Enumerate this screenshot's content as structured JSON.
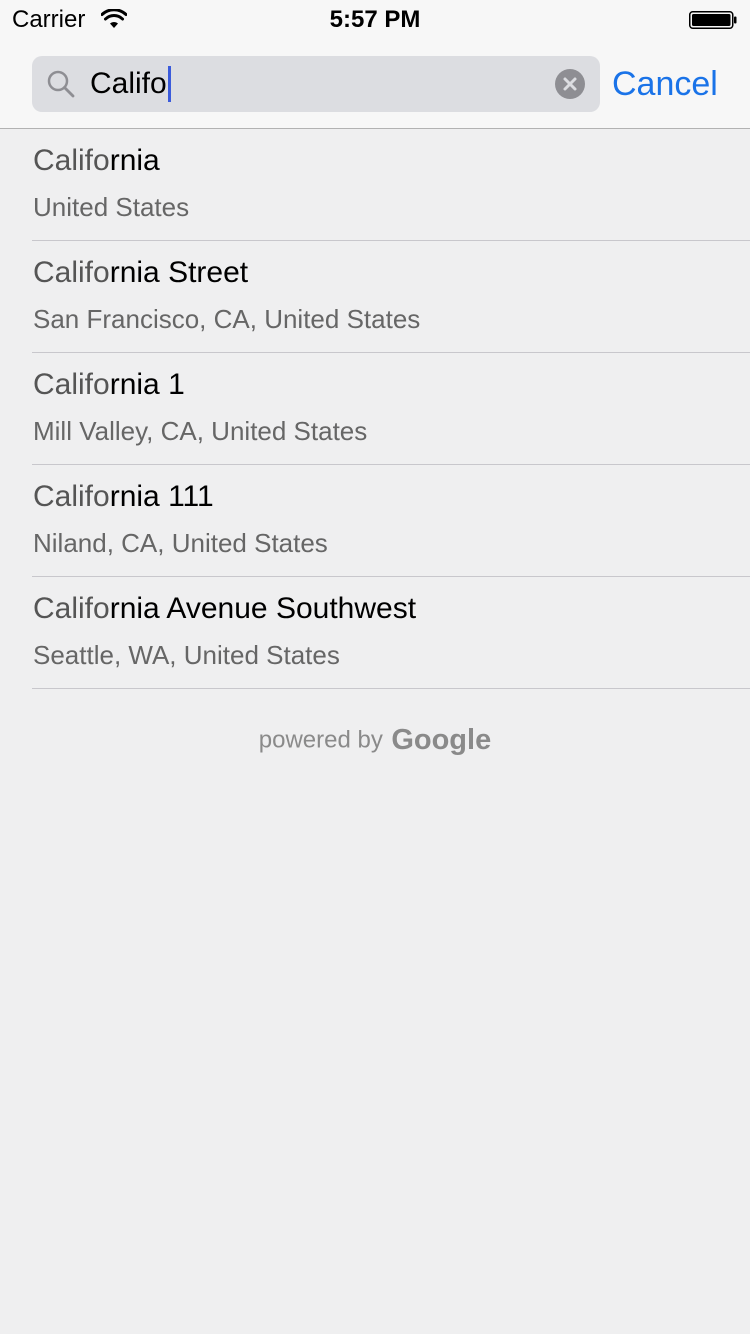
{
  "status_bar": {
    "carrier": "Carrier",
    "time": "5:57 PM",
    "icons": [
      "wifi-icon",
      "battery-icon"
    ]
  },
  "search": {
    "value": "Califo",
    "placeholder": "",
    "cancel_label": "Cancel",
    "icons": [
      "search-icon",
      "clear-icon"
    ],
    "accent_color": "#1a73e8",
    "caret_color": "#3b5bdb"
  },
  "results": [
    {
      "match": "Califo",
      "rest": "rnia",
      "subtitle": "United States"
    },
    {
      "match": "Califo",
      "rest": "rnia Street",
      "subtitle": "San Francisco, CA, United States"
    },
    {
      "match": "Califo",
      "rest": "rnia 1",
      "subtitle": "Mill Valley, CA, United States"
    },
    {
      "match": "Califo",
      "rest": "rnia 111",
      "subtitle": "Niland, CA, United States"
    },
    {
      "match": "Califo",
      "rest": "rnia Avenue Southwest",
      "subtitle": "Seattle, WA, United States"
    }
  ],
  "attribution": {
    "prefix": "powered by",
    "brand": "Google"
  }
}
